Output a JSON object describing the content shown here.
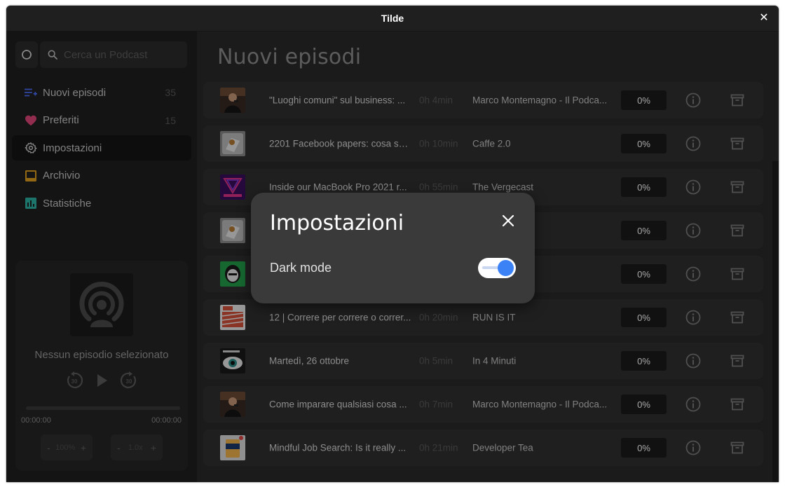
{
  "window": {
    "title": "Tilde"
  },
  "search": {
    "placeholder": "Cerca un Podcast"
  },
  "sidebar": {
    "items": [
      {
        "label": "Nuovi episodi",
        "count": "35"
      },
      {
        "label": "Preferiti",
        "count": "15"
      },
      {
        "label": "Impostazioni",
        "count": ""
      },
      {
        "label": "Archivio",
        "count": ""
      },
      {
        "label": "Statistiche",
        "count": ""
      }
    ]
  },
  "player": {
    "no_episode": "Nessun episodio selezionato",
    "elapsed": "00:00:00",
    "remaining": "00:00:00",
    "volume": "100%",
    "speed": "1.0x",
    "minus": "-",
    "plus": "+",
    "skip_back": "30",
    "skip_fwd": "30"
  },
  "main": {
    "heading": "Nuovi episodi",
    "episodes": [
      {
        "title": "\"Luoghi comuni\" sul business: ...",
        "duration": "0h 4min",
        "podcast": "Marco Montemagno - Il Podca...",
        "progress": "0%",
        "thumb": "montemagno"
      },
      {
        "title": "2201 Facebook papers: cosa so...",
        "duration": "0h 10min",
        "podcast": "Caffe 2.0",
        "progress": "0%",
        "thumb": "caffe"
      },
      {
        "title": "Inside our MacBook Pro 2021 r...",
        "duration": "0h 55min",
        "podcast": "The Vergecast",
        "progress": "0%",
        "thumb": "vergecast"
      },
      {
        "title": "",
        "duration": "",
        "podcast": "",
        "progress": "0%",
        "thumb": "caffe"
      },
      {
        "title": "",
        "duration": "",
        "podcast": "",
        "progress": "0%",
        "thumb": "green"
      },
      {
        "title": "12 | Correre per correre o correr...",
        "duration": "0h 20min",
        "podcast": "RUN IS IT",
        "progress": "0%",
        "thumb": "runisit"
      },
      {
        "title": "Martedì, 26 ottobre",
        "duration": "0h 5min",
        "podcast": "In 4 Minuti",
        "progress": "0%",
        "thumb": "in4minuti"
      },
      {
        "title": "Come imparare qualsiasi cosa ...",
        "duration": "0h 7min",
        "podcast": "Marco Montemagno - Il Podca...",
        "progress": "0%",
        "thumb": "montemagno"
      },
      {
        "title": "Mindful Job Search: Is it really ...",
        "duration": "0h 21min",
        "podcast": "Developer Tea",
        "progress": "0%",
        "thumb": "devtea"
      }
    ]
  },
  "dialog": {
    "title": "Impostazioni",
    "dark_mode_label": "Dark mode",
    "dark_mode_on": true
  },
  "colors": {
    "accent": "#3b82f6",
    "favorite": "#e0457b",
    "archive": "#e0a020",
    "stats": "#2bb3a3",
    "new": "#4a6cf7"
  }
}
